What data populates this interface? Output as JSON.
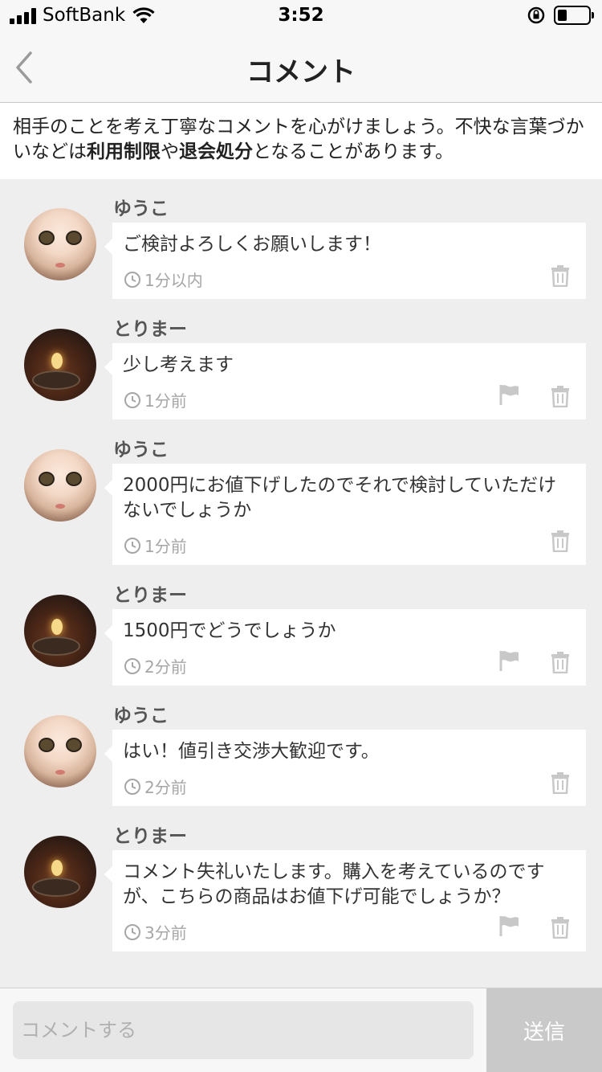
{
  "status_bar": {
    "carrier": "SoftBank",
    "time": "3:52",
    "battery_level": 0.3
  },
  "nav": {
    "title": "コメント",
    "back_icon": "chevron-left-icon"
  },
  "notice": {
    "part1": "相手のことを考え丁寧なコメントを心がけましょう。不快な言葉づかいなどは",
    "bold1": "利用制限",
    "part2": "や",
    "bold2": "退会処分",
    "part3": "となることがあります。"
  },
  "comments": [
    {
      "user": "ゆうこ",
      "avatar": "doll-avatar",
      "text": "ご検討よろしくお願いします！",
      "time": "1分以内",
      "flag": false
    },
    {
      "user": "とりまー",
      "avatar": "food-avatar",
      "text": "少し考えます",
      "time": "1分前",
      "flag": true
    },
    {
      "user": "ゆうこ",
      "avatar": "doll-avatar",
      "text": "2000円にお値下げしたのでそれで検討していただけないでしょうか",
      "time": "1分前",
      "flag": false
    },
    {
      "user": "とりまー",
      "avatar": "food-avatar",
      "text": "1500円でどうでしょうか",
      "time": "2分前",
      "flag": true
    },
    {
      "user": "ゆうこ",
      "avatar": "doll-avatar",
      "text": "はい！値引き交渉大歓迎です。",
      "time": "2分前",
      "flag": false
    },
    {
      "user": "とりまー",
      "avatar": "food-avatar",
      "text": "コメント失礼いたします。購入を考えているのですが、こちらの商品はお値下げ可能でしょうか？",
      "time": "3分前",
      "flag": true
    }
  ],
  "input": {
    "placeholder": "コメントする",
    "send_label": "送信"
  },
  "colors": {
    "background": "#eeeeee",
    "bubble": "#ffffff",
    "send_button": "#c9c9c9"
  }
}
